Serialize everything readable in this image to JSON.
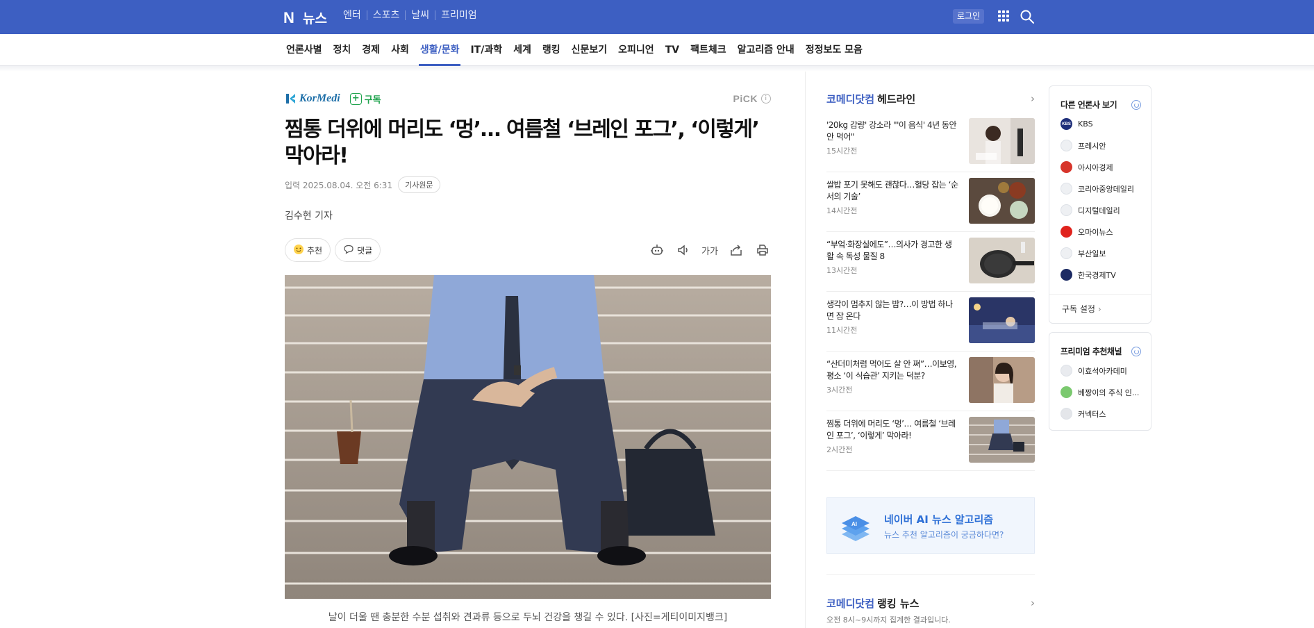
{
  "brand": {
    "logo_letter": "N",
    "site_name": "뉴스"
  },
  "top_nav": [
    "엔터",
    "스포츠",
    "날씨",
    "프리미엄"
  ],
  "header": {
    "login_label": "로그인"
  },
  "categories": [
    "언론사별",
    "정치",
    "경제",
    "사회",
    "생활/문화",
    "IT/과학",
    "세계",
    "랭킹",
    "신문보기",
    "오피니언",
    "TV",
    "팩트체크",
    "알고리즘 안내",
    "정정보도 모음"
  ],
  "active_category": "생활/문화",
  "article": {
    "press_name": "KorMedi",
    "subscribe_label": "구독",
    "pick_label": "PiCK",
    "title": "찜통 더위에 머리도 ‘멍’… 여름철 ‘브레인 포그’, ‘이렇게’ 막아라!",
    "input_date": "입력 2025.08.04. 오전 6:31",
    "original_label": "기사원문",
    "reporter": "김수현 기자",
    "recommend_label": "추천",
    "comment_label": "댓글",
    "font_size_label": "가가",
    "caption": "날이 더울 땐 충분한 수분 섭취와 견과류 등으로 두뇌 건강을 챙길 수 있다. [사진=게티이미지뱅크]"
  },
  "headlines_section": {
    "press_name": "코메디닷컴",
    "title": "헤드라인",
    "items": [
      {
        "title": "'20kg 감량' 강소라 \"'이 음식' 4년 동안 안 먹어\"",
        "age": "15시간전",
        "thumb": "woman-kitchen"
      },
      {
        "title": "쌀밥 포기 못해도 괜찮다…혈당 잡는 ‘순서의 기술’",
        "age": "14시간전",
        "thumb": "rice-table"
      },
      {
        "title": "“부엌·화장실에도”…의사가 경고한 생활 속 독성 물질 8",
        "age": "13시간전",
        "thumb": "frying-pan"
      },
      {
        "title": "생각이 멈추지 않는 밤?…이 방법 하나면 잠 온다",
        "age": "11시간전",
        "thumb": "night-bed"
      },
      {
        "title": "“산더미처럼 먹어도 살 안 쪄”…이보영, 평소 ‘이 식습관’ 지키는 덕분?",
        "age": "3시간전",
        "thumb": "actress"
      },
      {
        "title": "찜통 더위에 머리도 ‘멍’… 여름철 ‘브레인 포그’, ‘이렇게’ 막아라!",
        "age": "2시간전",
        "thumb": "stairs-man"
      }
    ]
  },
  "ai_banner": {
    "title": "네이버 AI 뉴스 알고리즘",
    "subtitle": "뉴스 추천 알고리즘이 궁금하다면?",
    "icon_text": "AI"
  },
  "ranking_section": {
    "press_name": "코메디닷컴",
    "title": "랭킹 뉴스",
    "description": "오전 8시~9시까지 집계한 결과입니다."
  },
  "other_press": {
    "title": "다른 언론사 보기",
    "items": [
      {
        "name": "KBS",
        "color": "#1f2f7a"
      },
      {
        "name": "프레시안",
        "color": "#cfd5de"
      },
      {
        "name": "아시아경제",
        "color": "#d7352b"
      },
      {
        "name": "코리아중앙데일리",
        "color": "#d6d9de"
      },
      {
        "name": "디지털데일리",
        "color": "#d9dbe0"
      },
      {
        "name": "오마이뉴스",
        "color": "#e0231d"
      },
      {
        "name": "부산일보",
        "color": "#dfe3ea"
      },
      {
        "name": "한국경제TV",
        "color": "#1c2a63"
      }
    ],
    "settings_label": "구독 설정"
  },
  "premium": {
    "title": "프리미엄 추천채널",
    "items": [
      {
        "name": "이효석아카데미",
        "color": "#e9ebef"
      },
      {
        "name": "베짱이의 주식 인...",
        "color": "#7bc96f"
      },
      {
        "name": "커넥터스",
        "color": "#e4e6ea"
      }
    ]
  },
  "colors": {
    "brand_blue": "#3d5fc2",
    "subscribe_green": "#1fa34d",
    "ai_blue": "#2d6fd6"
  }
}
